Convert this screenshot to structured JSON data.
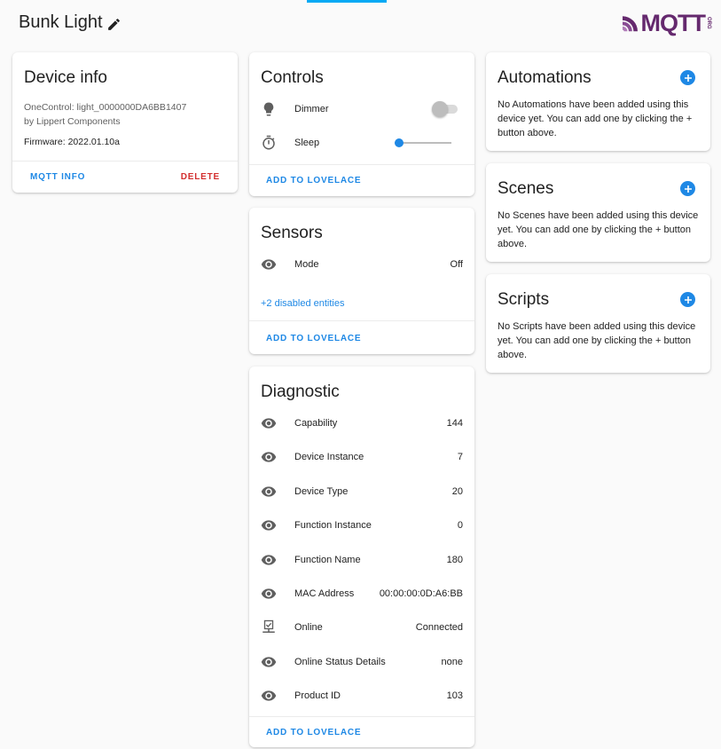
{
  "page": {
    "title": "Bunk Light"
  },
  "logo": {
    "text": "MQTT",
    "sub_text": "ORG"
  },
  "colors": {
    "accent": "#1e88e5",
    "danger": "#d32f2f",
    "icon": "#5f5f5f",
    "logo_purple": "#65296e"
  },
  "device_info": {
    "title": "Device info",
    "model": "OneControl: light_0000000DA6BB1407",
    "manufacturer": "by Lippert Components",
    "firmware": "Firmware: 2022.01.10a",
    "mqtt_info_label": "MQTT INFO",
    "delete_label": "DELETE"
  },
  "controls": {
    "title": "Controls",
    "dimmer": {
      "name": "Dimmer",
      "icon": "lightbulb-icon",
      "on": false
    },
    "sleep": {
      "name": "Sleep",
      "icon": "timer-icon",
      "level": 0
    },
    "add_to_lovelace_label": "ADD TO LOVELACE"
  },
  "sensors": {
    "title": "Sensors",
    "entities": [
      {
        "name": "Mode",
        "value": "Off",
        "icon": "eye-icon"
      }
    ],
    "disabled_label": "+2 disabled entities",
    "add_to_lovelace_label": "ADD TO LOVELACE"
  },
  "diagnostic": {
    "title": "Diagnostic",
    "entities": [
      {
        "name": "Capability",
        "value": "144",
        "icon": "eye-icon"
      },
      {
        "name": "Device Instance",
        "value": "7",
        "icon": "eye-icon"
      },
      {
        "name": "Device Type",
        "value": "20",
        "icon": "eye-icon"
      },
      {
        "name": "Function Instance",
        "value": "0",
        "icon": "eye-icon"
      },
      {
        "name": "Function Name",
        "value": "180",
        "icon": "eye-icon"
      },
      {
        "name": "MAC Address",
        "value": "00:00:00:0D:A6:BB",
        "icon": "eye-icon"
      },
      {
        "name": "Online",
        "value": "Connected",
        "icon": "network-icon"
      },
      {
        "name": "Online Status Details",
        "value": "none",
        "icon": "eye-icon"
      },
      {
        "name": "Product ID",
        "value": "103",
        "icon": "eye-icon"
      }
    ],
    "add_to_lovelace_label": "ADD TO LOVELACE"
  },
  "automations": {
    "title": "Automations",
    "text": "No Automations have been added using this device yet. You can add one by clicking the + button above."
  },
  "scenes": {
    "title": "Scenes",
    "text": "No Scenes have been added using this device yet. You can add one by clicking the + button above."
  },
  "scripts": {
    "title": "Scripts",
    "text": "No Scripts have been added using this device yet. You can add one by clicking the + button above."
  }
}
